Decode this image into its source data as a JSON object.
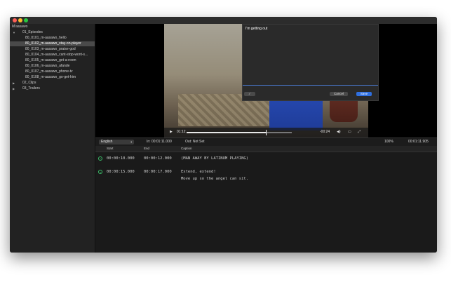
{
  "app": {
    "title": "M'aasawo"
  },
  "sidebar": {
    "root": "M'aasawo",
    "groups": [
      {
        "label": "01_Episodes",
        "expanded": true,
        "items": [
          {
            "label": "80_0101_m-aasawo_hello",
            "selected": false
          },
          {
            "label": "80_0102_m-aasawo_stay-on-player",
            "selected": true
          },
          {
            "label": "80_0103_m-aasawo_praise-god",
            "selected": false
          },
          {
            "label": "80_0104_m-aasawo_cant-stop-wont-s...",
            "selected": false
          },
          {
            "label": "80_0105_m-aasawo_get-a-room",
            "selected": false
          },
          {
            "label": "80_0106_m-aasawo_afande",
            "selected": false
          },
          {
            "label": "80_0107_m-aasawo_phone-tv",
            "selected": false
          },
          {
            "label": "80_0108_m-aasawo_go-get-him",
            "selected": false
          }
        ]
      },
      {
        "label": "02_Clips",
        "expanded": false,
        "items": []
      },
      {
        "label": "03_Trailers",
        "expanded": false,
        "items": []
      }
    ]
  },
  "editor": {
    "text": "I'm getting out",
    "options_glyph": "⁄",
    "cancel_label": "Cancel",
    "save_label": "Save"
  },
  "player": {
    "play_glyph": "▶",
    "current_time": "01:12",
    "remaining_time": "-00:24",
    "progress": 0.75,
    "volume_glyph": "◀)",
    "screen_glyph": "▭",
    "fullscreen_glyph": "⤢"
  },
  "infobar": {
    "language": "English",
    "in_point": "In: 00:01:11.000",
    "out_point": "Out: Not Set",
    "zoom": "100%",
    "duration": "00:01:11.905"
  },
  "captions": {
    "headers": {
      "start": "Start",
      "end": "End",
      "caption": "Caption"
    },
    "rows": [
      {
        "start": "00:00:10.000",
        "end": "00:00:12.000",
        "lines": [
          "(MAN AWAY BY LATINUM PLAYING)"
        ]
      },
      {
        "start": "00:00:15.000",
        "end": "00:00:17.000",
        "lines": [
          "Extend, extend!",
          "Move up so the angel can sit."
        ]
      }
    ]
  },
  "colors": {
    "accent": "#2f6fe0",
    "caption_icon": "#3bbf6a",
    "selection": "#4a4a4a"
  }
}
